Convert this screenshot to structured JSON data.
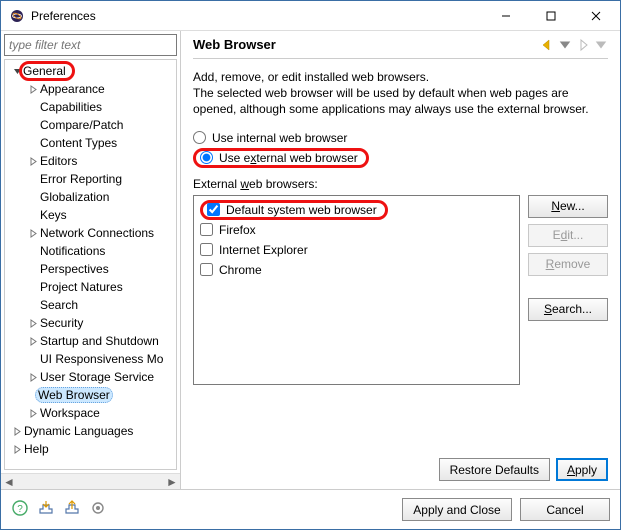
{
  "window": {
    "title": "Preferences"
  },
  "sidebar": {
    "filter_placeholder": "type filter text",
    "nodes": [
      {
        "label": "General",
        "depth": 0,
        "exp": true,
        "has_children": true,
        "highlight": true
      },
      {
        "label": "Appearance",
        "depth": 1,
        "exp": false,
        "has_children": true
      },
      {
        "label": "Capabilities",
        "depth": 1,
        "has_children": false
      },
      {
        "label": "Compare/Patch",
        "depth": 1,
        "has_children": false
      },
      {
        "label": "Content Types",
        "depth": 1,
        "has_children": false
      },
      {
        "label": "Editors",
        "depth": 1,
        "exp": false,
        "has_children": true
      },
      {
        "label": "Error Reporting",
        "depth": 1,
        "has_children": false
      },
      {
        "label": "Globalization",
        "depth": 1,
        "has_children": false
      },
      {
        "label": "Keys",
        "depth": 1,
        "has_children": false
      },
      {
        "label": "Network Connections",
        "depth": 1,
        "exp": false,
        "has_children": true
      },
      {
        "label": "Notifications",
        "depth": 1,
        "has_children": false
      },
      {
        "label": "Perspectives",
        "depth": 1,
        "has_children": false
      },
      {
        "label": "Project Natures",
        "depth": 1,
        "has_children": false
      },
      {
        "label": "Search",
        "depth": 1,
        "has_children": false
      },
      {
        "label": "Security",
        "depth": 1,
        "exp": false,
        "has_children": true
      },
      {
        "label": "Startup and Shutdown",
        "depth": 1,
        "exp": false,
        "has_children": true
      },
      {
        "label": "UI Responsiveness Mo",
        "depth": 1,
        "has_children": false
      },
      {
        "label": "User Storage Service",
        "depth": 1,
        "exp": false,
        "has_children": true
      },
      {
        "label": "Web Browser",
        "depth": 1,
        "has_children": false,
        "highlight": true,
        "selected": true
      },
      {
        "label": "Workspace",
        "depth": 1,
        "exp": false,
        "has_children": true
      },
      {
        "label": "Dynamic Languages",
        "depth": 0,
        "exp": false,
        "has_children": true
      },
      {
        "label": "Help",
        "depth": 0,
        "exp": false,
        "has_children": true
      }
    ]
  },
  "main": {
    "heading": "Web Browser",
    "description": "Add, remove, or edit installed web browsers.\nThe selected web browser will be used by default when web pages are opened, although some applications may always use the external browser.",
    "radio_internal": "Use internal web browser",
    "radio_external_pre": "Use e",
    "radio_external_u": "x",
    "radio_external_post": "ternal web browser",
    "selected_radio": "external",
    "list_label_pre": "External ",
    "list_label_u": "w",
    "list_label_post": "eb browsers:",
    "browsers": [
      {
        "label": "Default system web browser",
        "checked": true,
        "highlight": true
      },
      {
        "label": "Firefox",
        "checked": false
      },
      {
        "label": "Internet Explorer",
        "checked": false
      },
      {
        "label": "Chrome",
        "checked": false
      }
    ],
    "buttons": {
      "new_u": "N",
      "new_post": "ew...",
      "edit_pre": "E",
      "edit_u": "d",
      "edit_post": "it...",
      "remove_u": "R",
      "remove_post": "emove",
      "search_u": "S",
      "search_post": "earch..."
    },
    "restore": "Restore Defaults",
    "apply_u": "A",
    "apply_post": "pply"
  },
  "bottom": {
    "apply_close": "Apply and Close",
    "cancel": "Cancel"
  }
}
